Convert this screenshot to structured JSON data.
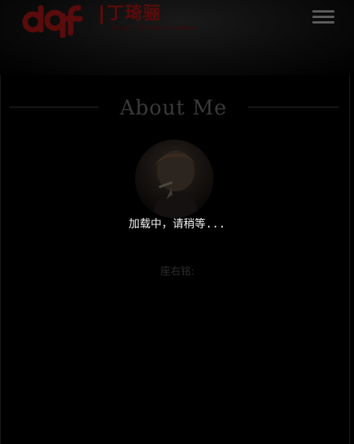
{
  "header": {
    "logo": {
      "mark_text": "dqf",
      "name": "丁琦骊",
      "subtitle": "Design Full Stack Developer",
      "brand_color": "#5a0b0b"
    },
    "menu_icon": "hamburger-icon"
  },
  "about": {
    "title": "About Me",
    "avatar_alt": "avatar"
  },
  "loading": {
    "text": "加载中，请稍等..."
  },
  "motto": {
    "label": "座右铭:"
  },
  "colors": {
    "background": "#000000",
    "accent": "#5a0b0b",
    "text": "#f2f2f2"
  }
}
